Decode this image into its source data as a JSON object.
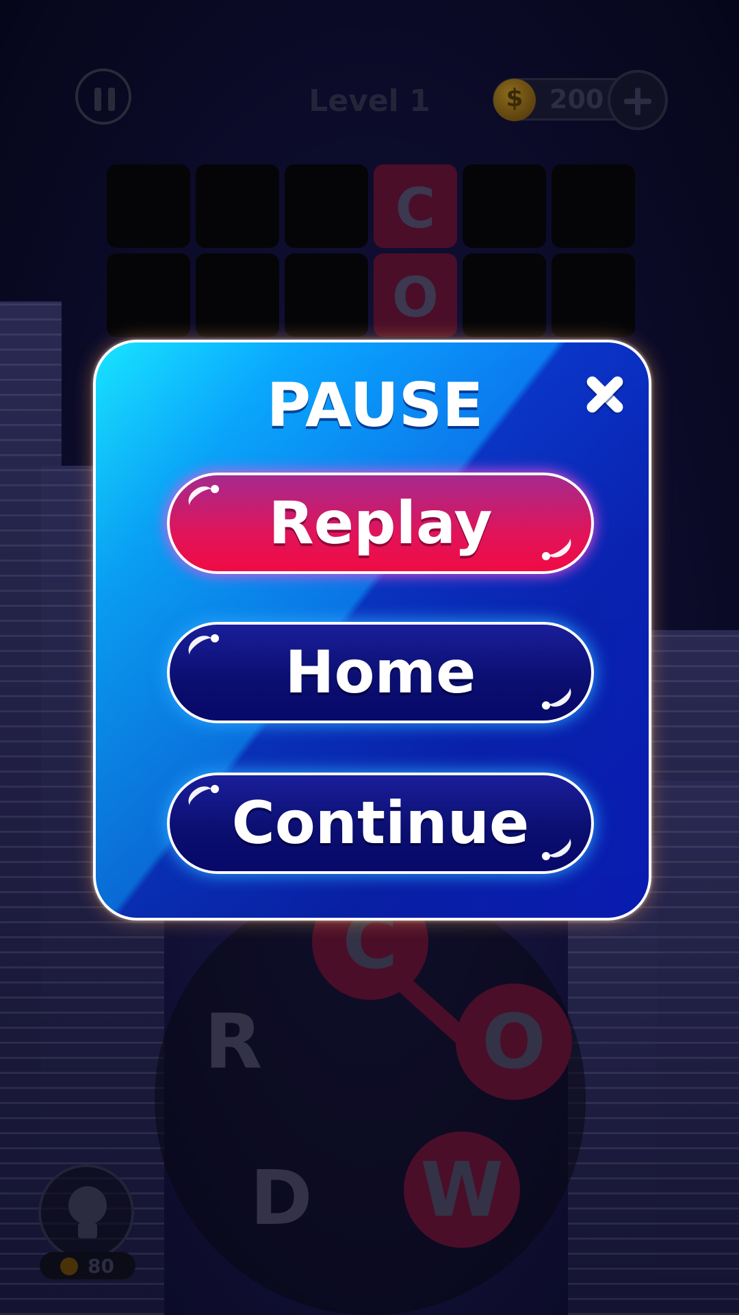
{
  "header": {
    "level_label": "Level 1",
    "coins": "200"
  },
  "board": {
    "cells": [
      "",
      "",
      "",
      "C",
      "",
      "",
      "",
      "",
      "",
      "O",
      "",
      ""
    ]
  },
  "wheel": {
    "letters": [
      "C",
      "R",
      "O",
      "D",
      "W"
    ]
  },
  "hint": {
    "cost": "80"
  },
  "pause_dialog": {
    "title": "PAUSE",
    "replay_label": "Replay",
    "home_label": "Home",
    "continue_label": "Continue"
  },
  "colors": {
    "dialog_top": "#18e4ff",
    "dialog_bottom": "#0a20c8",
    "replay_button": "#e0145a",
    "navy_button": "#0a0e6e"
  },
  "icons": [
    "pause-icon",
    "coin-icon",
    "plus-icon",
    "close-icon",
    "lightbulb-icon"
  ]
}
